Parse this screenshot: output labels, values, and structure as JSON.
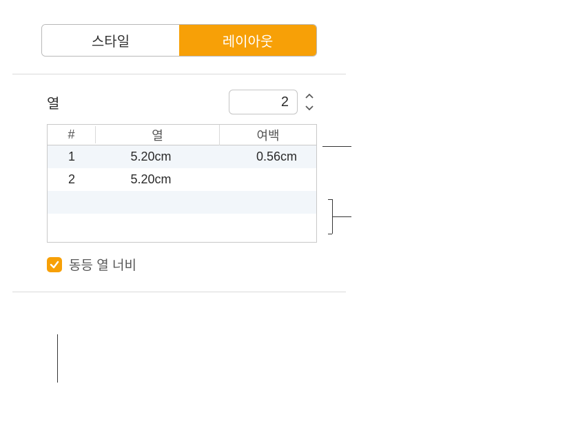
{
  "tabs": {
    "style": "스타일",
    "layout": "레이아웃"
  },
  "columns": {
    "label": "열",
    "value": "2"
  },
  "table": {
    "headers": {
      "num": "#",
      "col": "열",
      "gutter": "여백"
    },
    "rows": [
      {
        "num": "1",
        "width": "5.20cm",
        "gutter": "0.56cm"
      },
      {
        "num": "2",
        "width": "5.20cm",
        "gutter": ""
      }
    ]
  },
  "equalWidth": {
    "label": "동등 열 너비"
  }
}
